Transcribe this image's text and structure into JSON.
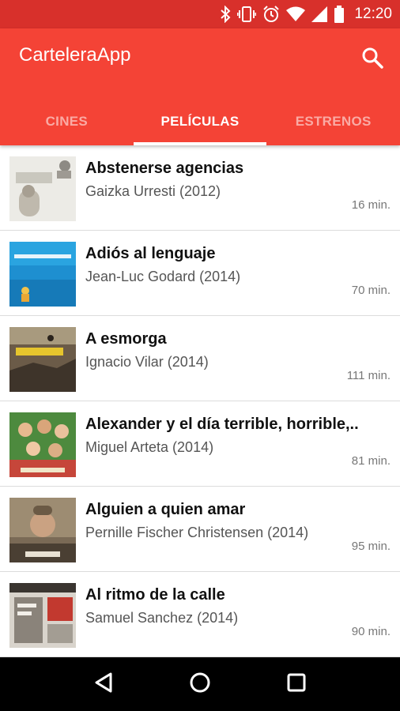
{
  "status_bar": {
    "time": "12:20",
    "icons": [
      "bluetooth-icon",
      "vibrate-icon",
      "alarm-icon",
      "wifi-icon",
      "signal-icon",
      "battery-icon"
    ]
  },
  "app_bar": {
    "title": "CarteleraApp",
    "search_icon": "search-icon",
    "color": "#f44336",
    "status_color": "#d8302b"
  },
  "tabs": [
    {
      "label": "CINES",
      "active": false
    },
    {
      "label": "PELÍCULAS",
      "active": true
    },
    {
      "label": "ESTRENOS",
      "active": false
    }
  ],
  "movies": [
    {
      "title": "Abstenerse agencias",
      "director": "Gaizka Urresti (2012)",
      "duration": "16 min."
    },
    {
      "title": "Adiós al lenguaje",
      "director": "Jean-Luc Godard (2014)",
      "duration": "70 min."
    },
    {
      "title": "A esmorga",
      "director": "Ignacio Vilar (2014)",
      "duration": "111 min."
    },
    {
      "title": "Alexander y el día terrible, horrible,..",
      "director": "Miguel Arteta (2014)",
      "duration": "81 min."
    },
    {
      "title": "Alguien a quien amar",
      "director": "Pernille Fischer Christensen (2014)",
      "duration": "95 min."
    },
    {
      "title": "Al ritmo de la calle",
      "director": "Samuel Sanchez (2014)",
      "duration": "90 min."
    }
  ],
  "nav_bar": {
    "icons": [
      "back-icon",
      "home-icon",
      "recents-icon"
    ]
  }
}
